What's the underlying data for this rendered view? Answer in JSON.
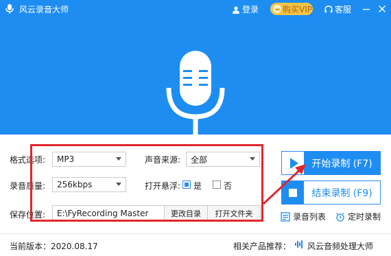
{
  "titlebar": {
    "app_title": "风云录音大师",
    "login_label": "登录",
    "vip_label": "购买VIP",
    "support_label": "客服"
  },
  "settings": {
    "format_label": "格式选项:",
    "format_value": "MP3",
    "source_label": "声音来源:",
    "source_value": "全部",
    "quality_label": "录音质量:",
    "quality_value": "256kbps",
    "float_label": "打开悬浮:",
    "float_yes": "是",
    "float_no": "否",
    "float_selected": "是",
    "save_label": "保存位置:",
    "save_path": "E:\\FyRecording Master",
    "change_dir_label": "更改目录",
    "open_folder_label": "打开文件夹"
  },
  "actions": {
    "start_label": "开始录制 (F7)",
    "stop_label": "结束录制 (F9)",
    "record_list_label": "录音列表",
    "timed_record_label": "定时录制"
  },
  "footer": {
    "version": "当前版本：2020.08.17",
    "related_label": "相关产品推荐：",
    "related_app": "风云音频处理大师"
  },
  "colors": {
    "brand_blue": "#1e8df2",
    "highlight_red": "#e0272b",
    "vip_gold": "#f6c545"
  }
}
